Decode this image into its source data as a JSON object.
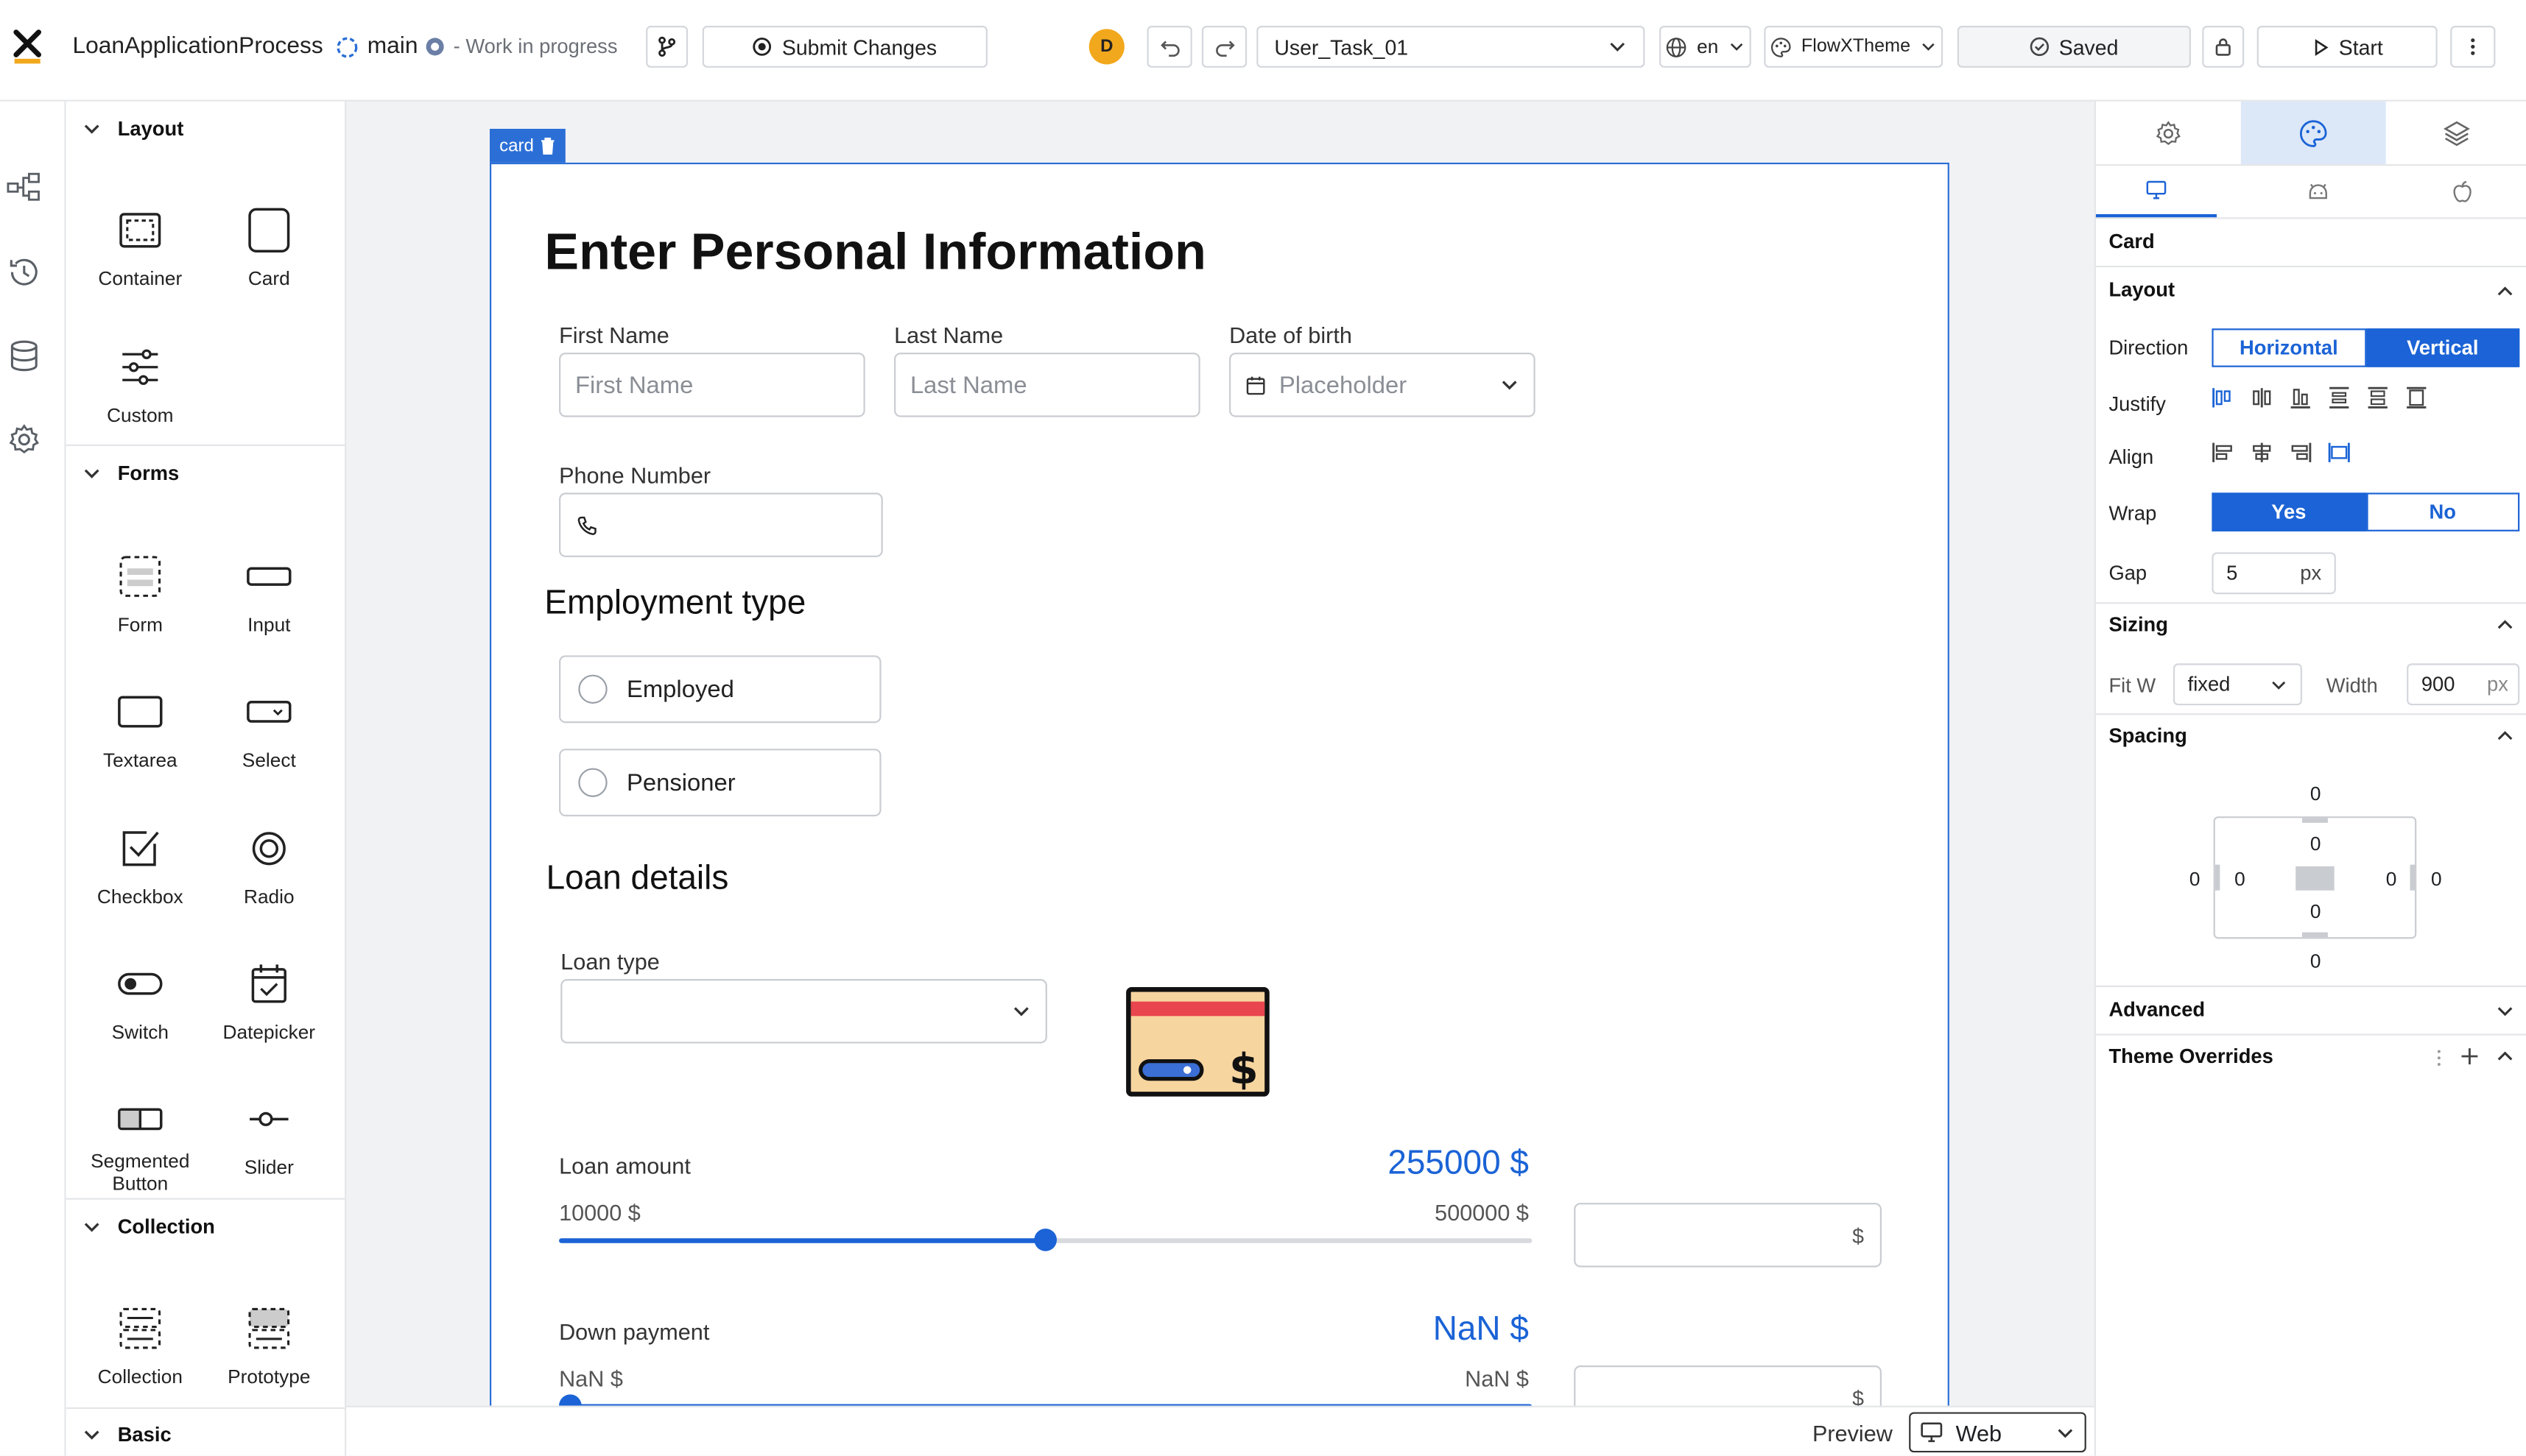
{
  "topbar": {
    "app_title": "LoanApplicationProcess",
    "branch": "main",
    "status": "- Work in progress",
    "submit_label": "Submit Changes",
    "avatar_initial": "D",
    "task_select": "User_Task_01",
    "language": "en",
    "theme": "FlowXTheme",
    "saved_label": "Saved",
    "start_label": "Start",
    "avatar_color": "#f2a81d"
  },
  "palette": {
    "sections": {
      "layout": "Layout",
      "forms": "Forms",
      "collection": "Collection",
      "basic": "Basic"
    },
    "layout_items": [
      "Container",
      "Card",
      "Custom"
    ],
    "forms_items": [
      "Form",
      "Input",
      "Textarea",
      "Select",
      "Checkbox",
      "Radio",
      "Switch",
      "Datepicker",
      "Segmented Button",
      "Slider"
    ],
    "collection_items": [
      "Collection",
      "Prototype"
    ]
  },
  "canvas": {
    "card_tag": "card",
    "title": "Enter Personal Information",
    "first_name_label": "First Name",
    "first_name_placeholder": "First Name",
    "last_name_label": "Last Name",
    "last_name_placeholder": "Last Name",
    "dob_label": "Date of birth",
    "dob_placeholder": "Placeholder",
    "phone_label": "Phone Number",
    "employment_heading": "Employment type",
    "employment_options": [
      "Employed",
      "Pensioner"
    ],
    "loan_heading": "Loan details",
    "loan_type_label": "Loan type",
    "loan_amount": {
      "label": "Loan amount",
      "value_text": "255000 $",
      "min_text": "10000 $",
      "max_text": "500000 $",
      "unit": "$",
      "min": 10000,
      "max": 500000,
      "value": 255000
    },
    "down_payment": {
      "label": "Down payment",
      "value_text": "NaN $",
      "min_text": "NaN $",
      "max_text": "NaN $",
      "unit": "$"
    },
    "accent_color": "#1b63d6"
  },
  "bottombar": {
    "preview_label": "Preview",
    "platform": "Web"
  },
  "rpanel": {
    "component": "Card",
    "layout_header": "Layout",
    "direction_label": "Direction",
    "direction_options": [
      "Horizontal",
      "Vertical"
    ],
    "direction_selected": "Vertical",
    "justify_label": "Justify",
    "align_label": "Align",
    "wrap_label": "Wrap",
    "wrap_options": [
      "Yes",
      "No"
    ],
    "wrap_selected": "Yes",
    "gap_label": "Gap",
    "gap_value": "5",
    "gap_unit": "px",
    "sizing_header": "Sizing",
    "fitw_label": "Fit W",
    "fitw_value": "fixed",
    "width_label": "Width",
    "width_value": "900",
    "width_unit": "px",
    "spacing_header": "Spacing",
    "spacing": {
      "margin_top": "0",
      "margin_bottom": "0",
      "margin_left": "0",
      "margin_right": "0",
      "padding_top": "0",
      "padding_bottom": "0",
      "padding_left": "0",
      "padding_right": "0"
    },
    "advanced_header": "Advanced",
    "theme_overrides_header": "Theme Overrides"
  }
}
